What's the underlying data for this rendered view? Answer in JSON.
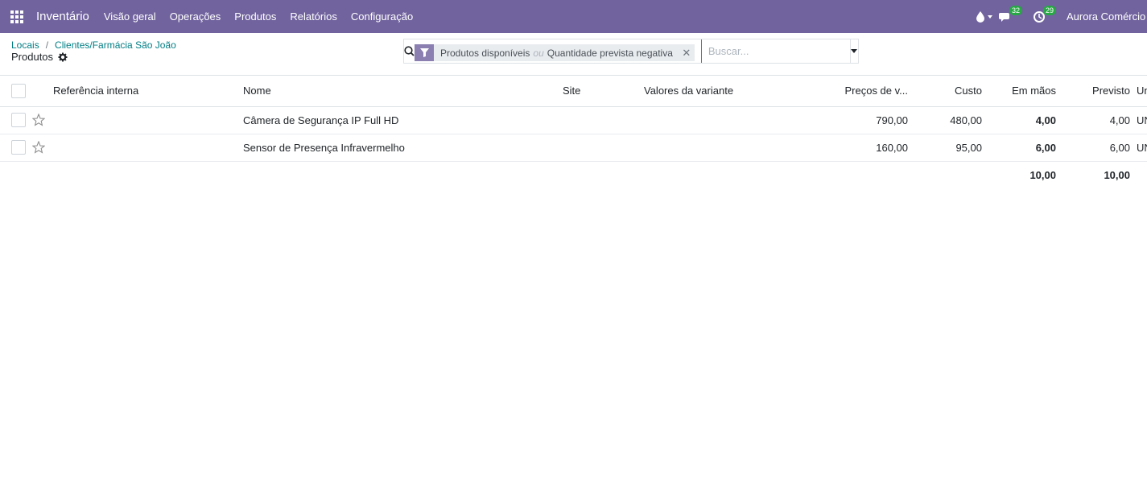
{
  "navbar": {
    "app_name": "Inventário",
    "menu": [
      "Visão geral",
      "Operações",
      "Produtos",
      "Relatórios",
      "Configuração"
    ],
    "messages_count": "32",
    "activities_count": "29",
    "user": "Aurora Comércio",
    "icons": [
      "apps-grid-icon",
      "drop-icon",
      "chat-icon",
      "clock-icon"
    ],
    "bg_color": "#71639e"
  },
  "breadcrumb": {
    "items": [
      "Locais",
      "Clientes/Farmácia São João"
    ],
    "current": "Produtos"
  },
  "search": {
    "facet_values": [
      "Produtos disponíveis",
      "Quantidade prevista negativa"
    ],
    "facet_separator": "ou",
    "placeholder": "Buscar..."
  },
  "table": {
    "columns": [
      "Referência interna",
      "Nome",
      "Site",
      "Valores da variante",
      "Preços de v...",
      "Custo",
      "Em mãos",
      "Previsto",
      "Un"
    ],
    "rows": [
      {
        "ref": "",
        "name": "Câmera de Segurança IP Full HD",
        "site": "",
        "variant": "",
        "price": "790,00",
        "cost": "480,00",
        "on_hand": "4,00",
        "forecast": "4,00",
        "uom": "UN"
      },
      {
        "ref": "",
        "name": "Sensor de Presença Infravermelho",
        "site": "",
        "variant": "",
        "price": "160,00",
        "cost": "95,00",
        "on_hand": "6,00",
        "forecast": "6,00",
        "uom": "UN"
      }
    ],
    "totals": {
      "on_hand": "10,00",
      "forecast": "10,00"
    }
  }
}
